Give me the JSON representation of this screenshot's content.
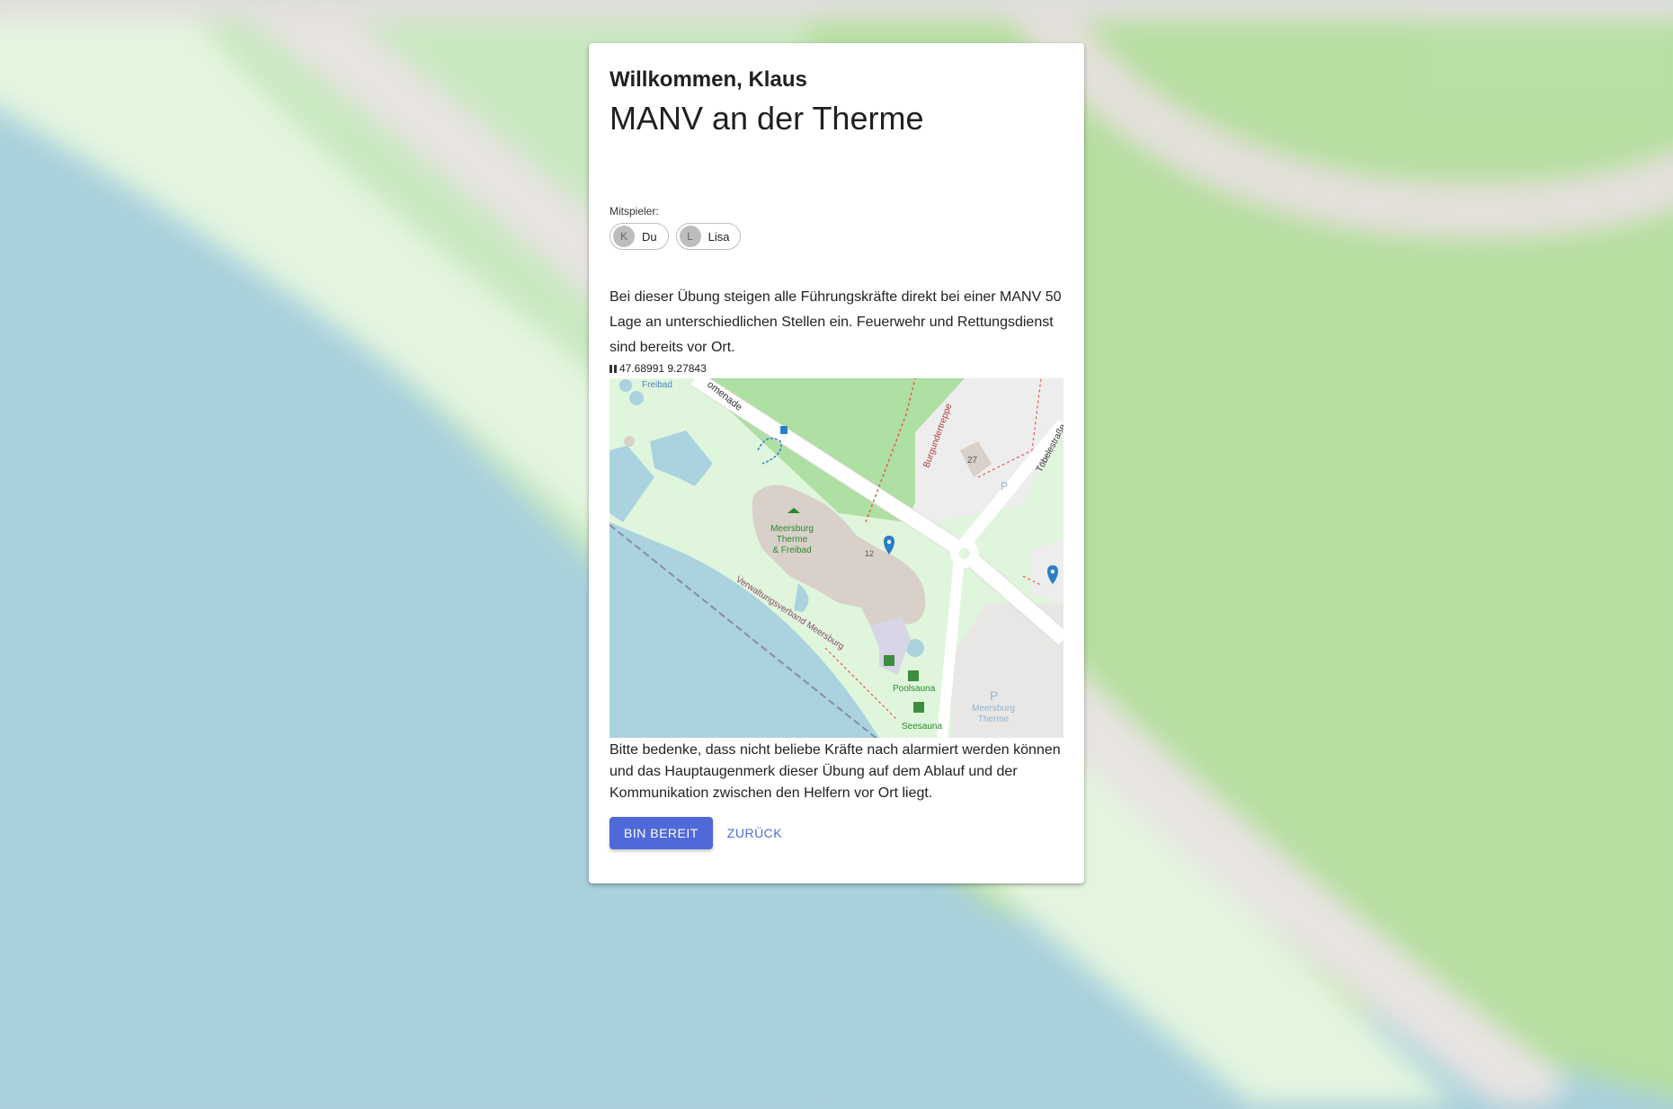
{
  "card": {
    "welcome": "Willkommen, Klaus",
    "title": "MANV an der Therme",
    "players_label": "Mitspieler:",
    "players": [
      {
        "initial": "K",
        "name": "Du"
      },
      {
        "initial": "L",
        "name": "Lisa"
      }
    ],
    "description": "Bei dieser Übung steigen alle Führungskräfte direkt bei einer MANV 50 Lage an unterschiedlichen Stellen ein. Feuerwehr und Rettungsdienst sind bereits vor Ort.",
    "coordinates": "47.68991 9.27843",
    "note": "Bitte bedenke, dass nicht beliebe Kräfte nach alarmiert werden können und das Hauptaugenmerk dieser Übung auf dem Ablauf und der Kommunikation zwischen den Helfern vor Ort liegt.",
    "primary_button": "BIN BEREIT",
    "secondary_button": "ZURÜCK"
  },
  "map": {
    "labels": {
      "freibad": "Freibad",
      "promenade": "omenade",
      "burgundertreppe": "Burgundertreppe",
      "toebelestrasse": "Töbelestraße",
      "number_27": "27",
      "number_12": "12",
      "therme_line1": "Meersburg",
      "therme_line2": "Therme",
      "therme_line3": "& Freibad",
      "verwaltung": "Verwaltungsverband Meersburg",
      "poolsauna": "Poolsauna",
      "seesauna": "Seesauna",
      "parking_line1": "Meersburg",
      "parking_line2": "Therme",
      "parking_symbol": "P",
      "parking_symbol_small": "P"
    },
    "colors": {
      "water": "#aad3df",
      "park": "#dff6dc",
      "vineyard": "#aedfa3",
      "building": "#d9d0c9",
      "road": "#ffffff",
      "marker": "#2a7fc6",
      "label_green": "#2b8a2b"
    },
    "icons": [
      "map-pin-icon",
      "parking-icon",
      "bus-stop-icon",
      "sauna-icon",
      "swimming-icon"
    ]
  }
}
